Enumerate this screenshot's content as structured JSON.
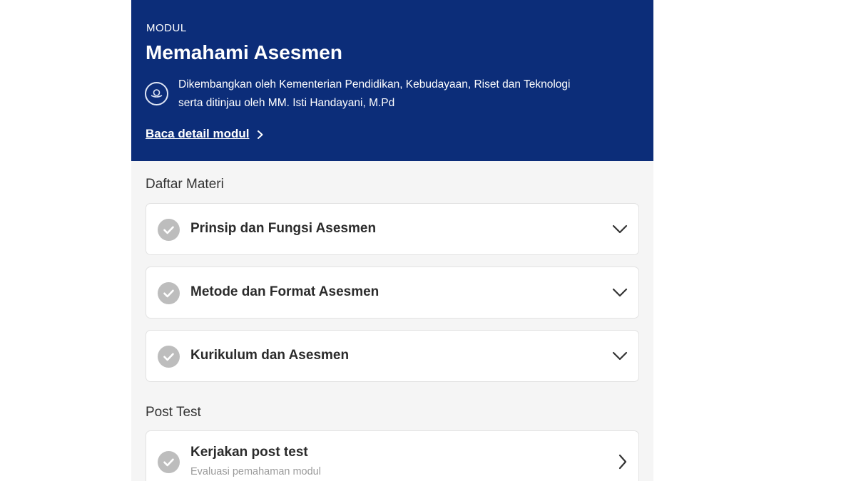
{
  "header": {
    "eyebrow": "MODUL",
    "title": "Memahami Asesmen",
    "author_line1": "Dikembangkan oleh Kementerian Pendidikan, Kebudayaan, Riset dan Teknologi",
    "author_line2": "serta ditinjau oleh MM. Isti Handayani, M.Pd",
    "detail_link": "Baca detail modul",
    "logo_icon": "ministry-logo-icon",
    "background_color": "#0c2d79"
  },
  "materials": {
    "section_label": "Daftar Materi",
    "items": [
      {
        "label": "Prinsip dan Fungsi Asesmen",
        "status_icon": "check-circle-icon",
        "expand_icon": "chevron-down-icon"
      },
      {
        "label": "Metode dan Format Asesmen",
        "status_icon": "check-circle-icon",
        "expand_icon": "chevron-down-icon"
      },
      {
        "label": "Kurikulum dan Asesmen",
        "status_icon": "check-circle-icon",
        "expand_icon": "chevron-down-icon"
      }
    ]
  },
  "post_test": {
    "section_label": "Post Test",
    "title": "Kerjakan post test",
    "subtitle": "Evaluasi pemahaman modul",
    "status_icon": "check-circle-icon",
    "action_icon": "chevron-right-icon"
  }
}
